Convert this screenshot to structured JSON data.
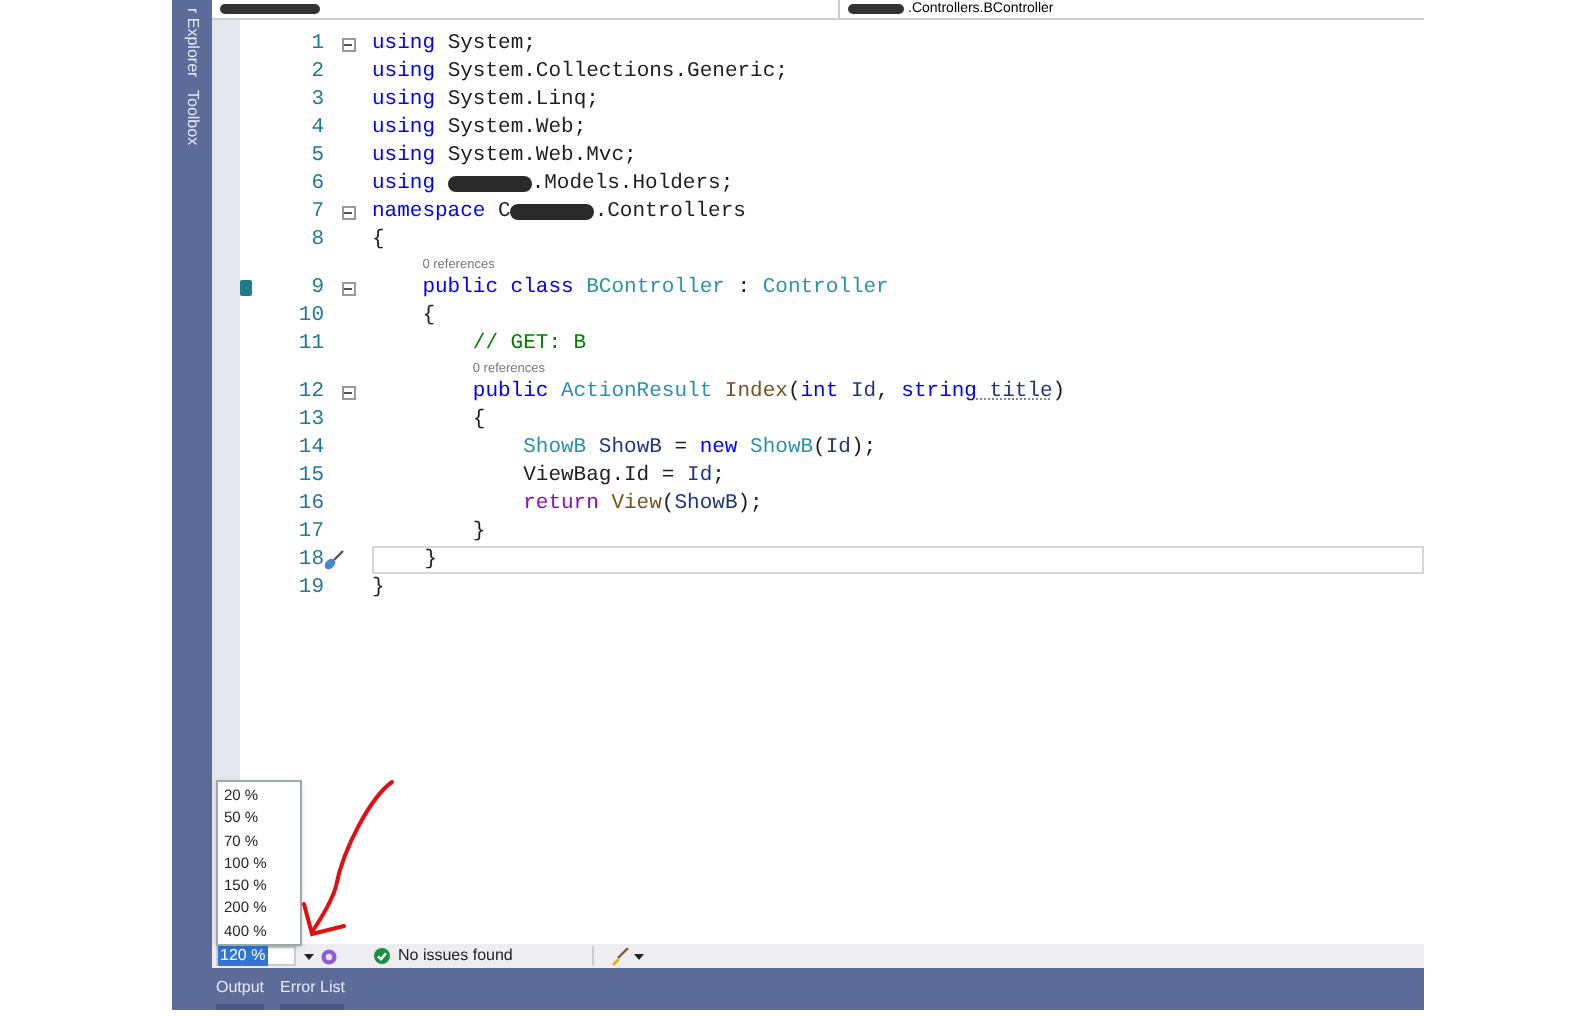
{
  "side_tabs": [
    "r Explorer",
    "Toolbox"
  ],
  "nav_bar": {
    "type_dropdown": ".Controllers.BController"
  },
  "code_lines": [
    {
      "kind": "code",
      "number": "1",
      "foldable": true,
      "tokens": [
        {
          "kind": "keyword",
          "text": "using"
        },
        {
          "kind": "plain",
          "text": " System;"
        }
      ]
    },
    {
      "kind": "code",
      "number": "2",
      "foldable": false,
      "tokens": [
        {
          "kind": "keyword",
          "text": "using"
        },
        {
          "kind": "plain",
          "text": " System.Collections.Generic;"
        }
      ]
    },
    {
      "kind": "code",
      "number": "3",
      "foldable": false,
      "tokens": [
        {
          "kind": "keyword",
          "text": "using"
        },
        {
          "kind": "plain",
          "text": " System.Linq;"
        }
      ]
    },
    {
      "kind": "code",
      "number": "4",
      "foldable": false,
      "tokens": [
        {
          "kind": "keyword",
          "text": "using"
        },
        {
          "kind": "plain",
          "text": " System.Web;"
        }
      ]
    },
    {
      "kind": "code",
      "number": "5",
      "foldable": false,
      "tokens": [
        {
          "kind": "keyword",
          "text": "using"
        },
        {
          "kind": "plain",
          "text": " System.Web.Mvc;"
        }
      ]
    },
    {
      "kind": "code",
      "number": "6",
      "foldable": false,
      "tokens": [
        {
          "kind": "keyword",
          "text": "using "
        },
        {
          "kind": "redacted"
        },
        {
          "kind": "plain",
          "text": ".Models.Holders;"
        }
      ]
    },
    {
      "kind": "code",
      "number": "7",
      "foldable": true,
      "tokens": [
        {
          "kind": "keyword",
          "text": "namespace"
        },
        {
          "kind": "plain",
          "text": " C"
        },
        {
          "kind": "redacted"
        },
        {
          "kind": "plain",
          "text": ".Controllers"
        }
      ]
    },
    {
      "kind": "code",
      "number": "8",
      "foldable": false,
      "tokens": [
        {
          "kind": "plain",
          "text": "{"
        }
      ]
    },
    {
      "kind": "lens",
      "text": "0 references"
    },
    {
      "kind": "code",
      "number": "9",
      "foldable": true,
      "glyph": {
        "kind": "hierarchy"
      },
      "tokens": [
        {
          "kind": "keyword",
          "text": "public class"
        },
        {
          "kind": "type",
          "text": " BController"
        },
        {
          "kind": "plain",
          "text": " : "
        },
        {
          "kind": "type",
          "text": "Controller"
        }
      ]
    },
    {
      "kind": "code",
      "number": "10",
      "foldable": false,
      "tokens": [
        {
          "kind": "plain",
          "text": "{"
        }
      ]
    },
    {
      "kind": "code",
      "number": "11",
      "foldable": false,
      "tokens": [
        {
          "kind": "comment",
          "text": "// GET: B"
        }
      ]
    },
    {
      "kind": "lens",
      "text": "0 references"
    },
    {
      "kind": "code",
      "number": "12",
      "foldable": true,
      "tokens": [
        {
          "kind": "keyword",
          "text": "public"
        },
        {
          "kind": "type",
          "text": " ActionResult"
        },
        {
          "kind": "method",
          "text": " Index"
        },
        {
          "kind": "plain",
          "text": "("
        },
        {
          "kind": "keyword",
          "text": "int"
        },
        {
          "kind": "param",
          "text": " Id"
        },
        {
          "kind": "plain",
          "text": ", "
        },
        {
          "kind": "keyword",
          "text": "string"
        },
        {
          "kind": "hinted",
          "text": " title"
        },
        {
          "kind": "plain",
          "text": ")"
        }
      ]
    },
    {
      "kind": "code",
      "number": "13",
      "foldable": false,
      "tokens": [
        {
          "kind": "plain",
          "text": "{"
        }
      ]
    },
    {
      "kind": "code",
      "number": "14",
      "foldable": false,
      "tokens": [
        {
          "kind": "type",
          "text": "ShowB"
        },
        {
          "kind": "local",
          "text": " ShowB"
        },
        {
          "kind": "plain",
          "text": " = "
        },
        {
          "kind": "keyword",
          "text": "new"
        },
        {
          "kind": "type",
          "text": " ShowB"
        },
        {
          "kind": "plain",
          "text": "("
        },
        {
          "kind": "param",
          "text": "Id"
        },
        {
          "kind": "plain",
          "text": ");"
        }
      ]
    },
    {
      "kind": "code",
      "number": "15",
      "foldable": false,
      "tokens": [
        {
          "kind": "plain",
          "text": "ViewBag.Id = "
        },
        {
          "kind": "param",
          "text": "Id"
        },
        {
          "kind": "plain",
          "text": ";"
        }
      ]
    },
    {
      "kind": "code",
      "number": "16",
      "foldable": false,
      "tokens": [
        {
          "kind": "control",
          "text": "return"
        },
        {
          "kind": "method",
          "text": " View"
        },
        {
          "kind": "plain",
          "text": "("
        },
        {
          "kind": "local",
          "text": "ShowB"
        },
        {
          "kind": "plain",
          "text": ");"
        }
      ]
    },
    {
      "kind": "code",
      "number": "17",
      "foldable": false,
      "tokens": [
        {
          "kind": "plain",
          "text": "}"
        }
      ]
    },
    {
      "kind": "code",
      "number": "18",
      "foldable": false,
      "current": true,
      "glyph": {
        "kind": "quick_action"
      },
      "tokens": [
        {
          "kind": "plain",
          "text": "}"
        }
      ]
    },
    {
      "kind": "code",
      "number": "19",
      "foldable": false,
      "tokens": [
        {
          "kind": "plain",
          "text": "}"
        }
      ]
    }
  ],
  "zoom_menu": [
    "20 %",
    "50 %",
    "70 %",
    "100 %",
    "150 %",
    "200 %",
    "400 %"
  ],
  "status_bar": {
    "zoom": "120 %",
    "issues": "No issues found"
  },
  "bottom_tabs": [
    "Output",
    "Error List"
  ]
}
